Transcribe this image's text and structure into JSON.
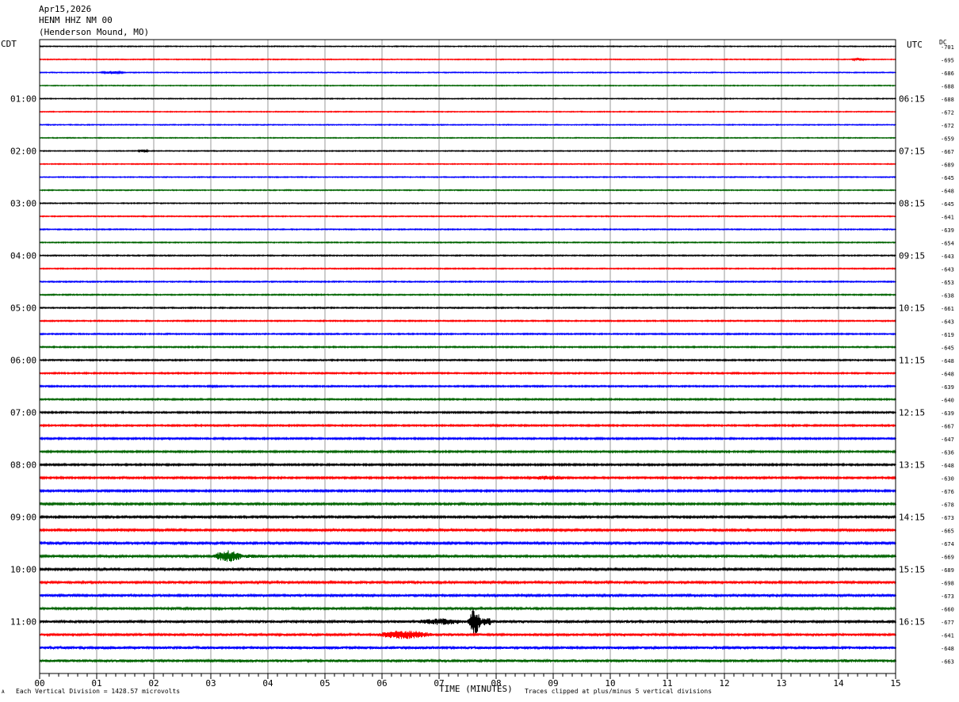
{
  "header": {
    "date": "Apr15,2026",
    "station": "HENM HHZ NM 00",
    "location": "(Henderson Mound, MO)"
  },
  "left_tz": "CDT",
  "right_tz": "UTC",
  "dc_label": "DC",
  "footer": {
    "mark": "A",
    "scale": "Each Vertical Division = 1428.57 microvolts",
    "clip_note": "Traces clipped at plus/minus 5 vertical divisions"
  },
  "chart_data": {
    "type": "line",
    "title": "",
    "xlabel": "TIME (MINUTES)",
    "xlim": [
      0,
      15
    ],
    "x_ticks": [
      "00",
      "01",
      "02",
      "03",
      "04",
      "05",
      "06",
      "07",
      "08",
      "09",
      "10",
      "11",
      "12",
      "13",
      "14",
      "15"
    ],
    "trace_colors": [
      "#000000",
      "#ff0000",
      "#0000ff",
      "#006400"
    ],
    "left_hour_labels": [
      "01:00",
      "02:00",
      "03:00",
      "04:00",
      "05:00",
      "06:00",
      "07:00",
      "08:00",
      "09:00",
      "10:00",
      "11:00"
    ],
    "right_hour_labels": [
      "06:15",
      "07:15",
      "08:15",
      "09:15",
      "10:15",
      "11:15",
      "12:15",
      "13:15",
      "14:15",
      "15:15",
      "16:15"
    ],
    "dc_offsets": [
      "701",
      "695",
      "686",
      "688",
      "688",
      "672",
      "672",
      "659",
      "667",
      "689",
      "645",
      "648",
      "645",
      "641",
      "639",
      "654",
      "643",
      "643",
      "653",
      "638",
      "661",
      "643",
      "619",
      "645",
      "648",
      "648",
      "639",
      "640",
      "639",
      "667",
      "647",
      "636",
      "648",
      "630",
      "676",
      "678",
      "673",
      "665",
      "674",
      "669",
      "689",
      "698",
      "673",
      "660",
      "677",
      "641",
      "648",
      "663"
    ],
    "events": [
      {
        "trace": 1,
        "start": 12.0,
        "end": 13.2,
        "amp": 0.6
      },
      {
        "trace": 1,
        "start": 14.2,
        "end": 14.7,
        "amp": 2.2
      },
      {
        "trace": 2,
        "start": 1.0,
        "end": 1.9,
        "amp": 2.0
      },
      {
        "trace": 8,
        "start": 1.7,
        "end": 2.1,
        "amp": 2.2
      },
      {
        "trace": 22,
        "start": 6.9,
        "end": 7.5,
        "amp": 0.6
      },
      {
        "trace": 26,
        "start": 2.9,
        "end": 3.4,
        "amp": 1.6
      },
      {
        "trace": 28,
        "start": 10.2,
        "end": 10.9,
        "amp": 2.2
      },
      {
        "trace": 29,
        "start": 7.8,
        "end": 8.4,
        "amp": 1.6
      },
      {
        "trace": 29,
        "start": 13.1,
        "end": 13.5,
        "amp": 1.6
      },
      {
        "trace": 30,
        "start": 2.0,
        "end": 2.7,
        "amp": 1.8
      },
      {
        "trace": 33,
        "start": 8.4,
        "end": 10.2,
        "amp": 3.2
      },
      {
        "trace": 36,
        "start": 2.7,
        "end": 3.0,
        "amp": 2.2
      },
      {
        "trace": 37,
        "start": 0.4,
        "end": 0.8,
        "amp": 2.0
      },
      {
        "trace": 39,
        "start": 3.0,
        "end": 4.0,
        "amp": 9.0
      },
      {
        "trace": 41,
        "start": 2.0,
        "end": 3.0,
        "amp": 1.8
      },
      {
        "trace": 41,
        "start": 11.0,
        "end": 11.5,
        "amp": 2.0
      },
      {
        "trace": 43,
        "start": 4.5,
        "end": 7.0,
        "amp": 1.6
      },
      {
        "trace": 44,
        "start": 6.5,
        "end": 8.3,
        "amp": 5.0
      },
      {
        "trace": 44,
        "start": 7.5,
        "end": 7.9,
        "amp": 19.0
      },
      {
        "trace": 45,
        "start": 5.8,
        "end": 7.8,
        "amp": 6.5
      },
      {
        "trace": 46,
        "start": 9.5,
        "end": 11.5,
        "amp": 1.2
      },
      {
        "trace": 47,
        "start": 3.4,
        "end": 3.8,
        "amp": 2.4
      },
      {
        "trace": 47,
        "start": 10.7,
        "end": 11.0,
        "amp": 2.6
      },
      {
        "trace": 47,
        "start": 14.0,
        "end": 14.5,
        "amp": 2.4
      }
    ]
  }
}
